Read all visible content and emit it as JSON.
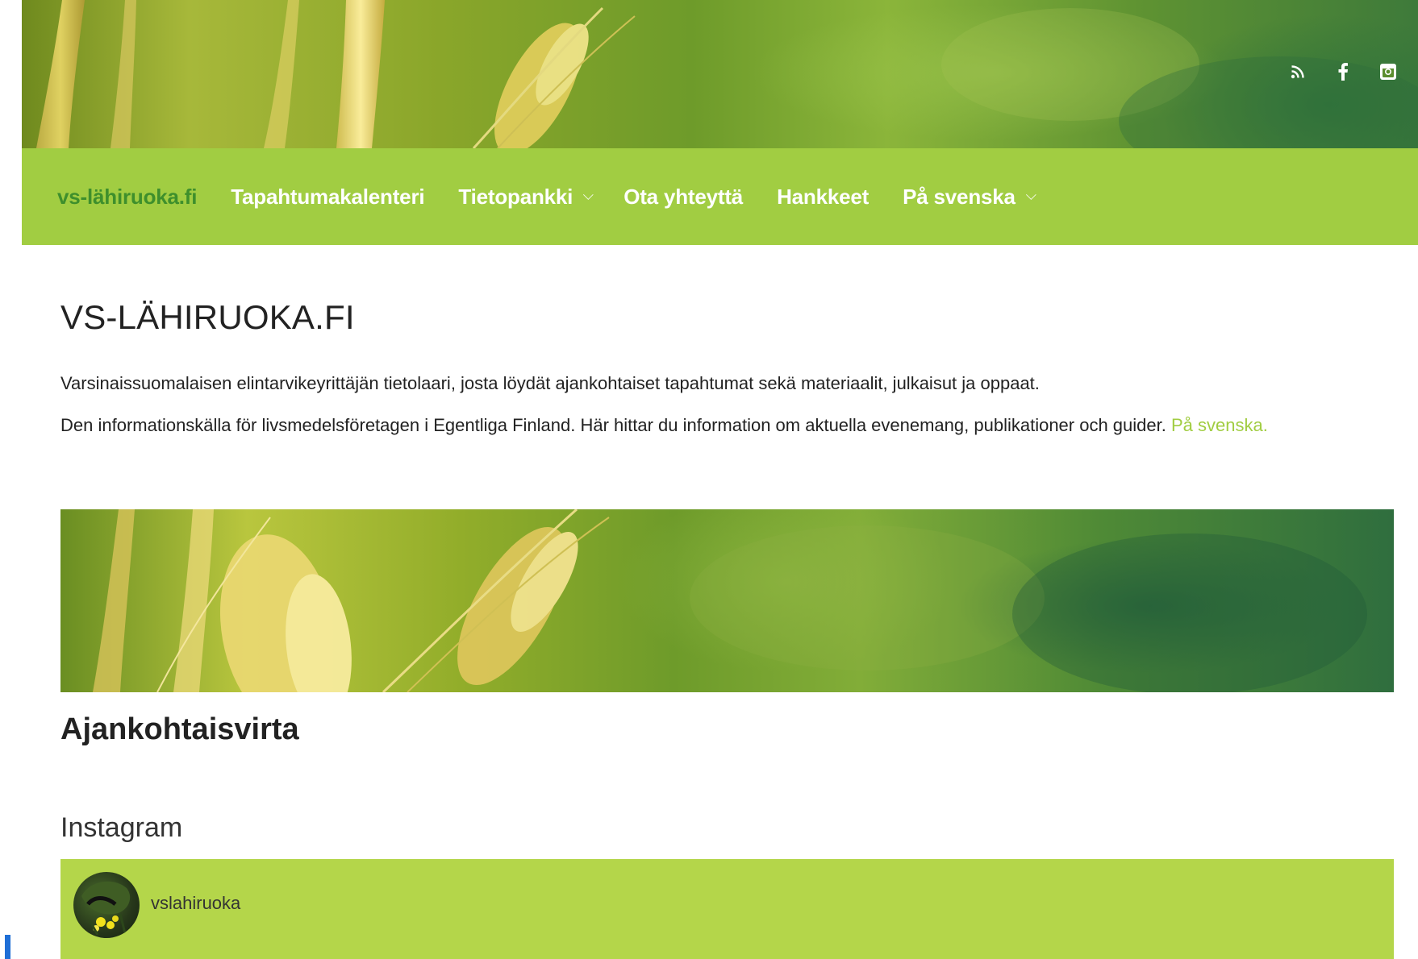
{
  "site": {
    "brand_color": "#a1cd42",
    "active_color": "#3e8f2c",
    "link_color": "#a1cd42"
  },
  "header": {
    "social_icons": [
      {
        "name": "rss-icon",
        "glyph": "rss"
      },
      {
        "name": "facebook-icon",
        "glyph": "f"
      },
      {
        "name": "instagram-icon",
        "glyph": "instagram"
      }
    ]
  },
  "nav": {
    "items": [
      {
        "label": "vs-lähiruoka.fi",
        "active": true,
        "has_dropdown": false
      },
      {
        "label": "Tapahtumakalenteri",
        "active": false,
        "has_dropdown": false
      },
      {
        "label": "Tietopankki",
        "active": false,
        "has_dropdown": true
      },
      {
        "label": "Ota yhteyttä",
        "active": false,
        "has_dropdown": false
      },
      {
        "label": "Hankkeet",
        "active": false,
        "has_dropdown": false
      },
      {
        "label": "På svenska",
        "active": false,
        "has_dropdown": true
      }
    ]
  },
  "main": {
    "title": "VS-LÄHIRUOKA.FI",
    "intro_fi": "Varsinaissuomalaisen elintarvikeyrittäjän tietolaari, josta löydät ajankohtaiset tapahtumat sekä materiaalit, julkaisut ja oppaat.",
    "intro_sv": "Den informationskälla för livsmedelsföretagen i Egentliga Finland. Här hittar du information om aktuella evenemang, publikationer och guider.",
    "intro_sv_link": "På svenska.",
    "section_title": "Ajankohtaisvirta",
    "instagram_heading": "Instagram"
  },
  "instagram": {
    "username": "vslahiruoka",
    "card_color": "#b4d64a"
  }
}
